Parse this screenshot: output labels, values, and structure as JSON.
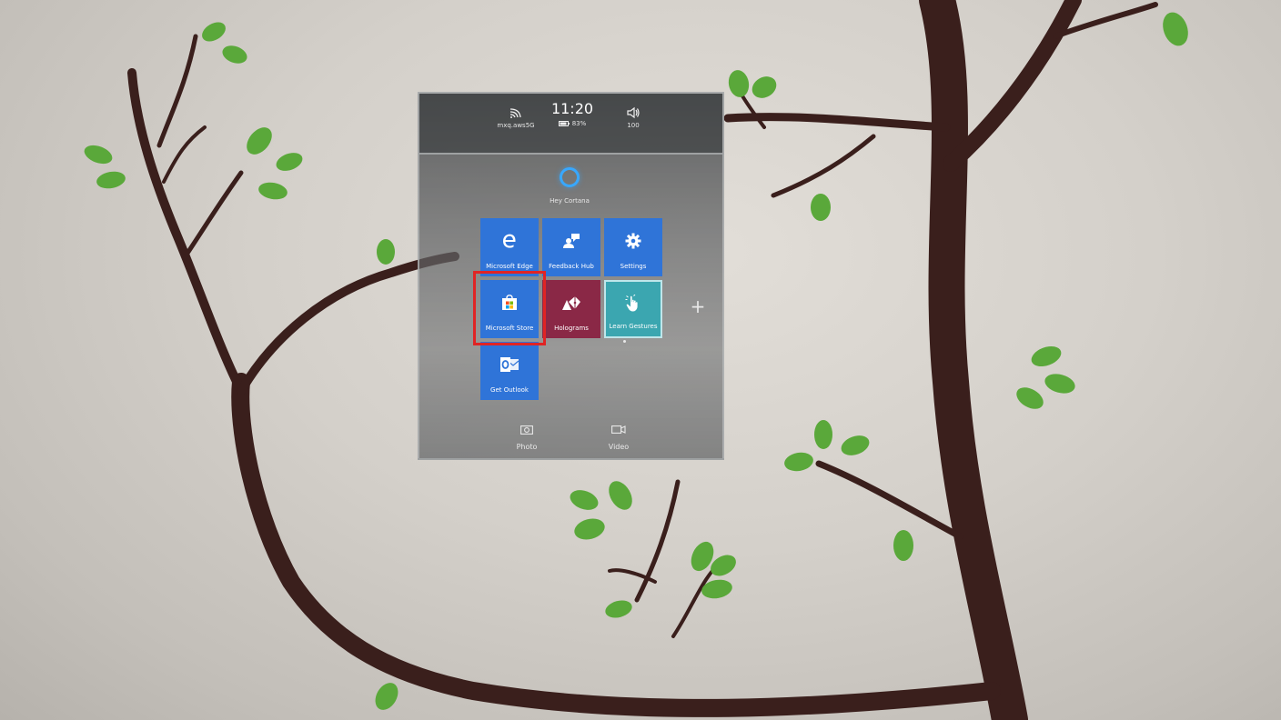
{
  "status_bar": {
    "wifi_name": "mxq.aws5G",
    "time": "11:20",
    "battery": "83%",
    "volume": "100"
  },
  "cortana": {
    "label": "Hey Cortana"
  },
  "tiles": [
    {
      "label": "Microsoft Edge",
      "icon": "edge-icon",
      "color": "#2f74d8"
    },
    {
      "label": "Feedback Hub",
      "icon": "feedback-icon",
      "color": "#2f74d8"
    },
    {
      "label": "Settings",
      "icon": "gear-icon",
      "color": "#2f74d8"
    },
    {
      "label": "Microsoft Store",
      "icon": "store-bag-icon",
      "color": "#2f74d8"
    },
    {
      "label": "Holograms",
      "icon": "holograms-icon",
      "color": "#8a2846"
    },
    {
      "label": "Learn Gestures",
      "icon": "hand-tap-icon",
      "color": "#3ba6b0"
    },
    {
      "label": "Get Outlook",
      "icon": "outlook-icon",
      "color": "#2f74d8"
    }
  ],
  "add_tile": {
    "symbol": "+"
  },
  "bottom_actions": {
    "photo_label": "Photo",
    "video_label": "Video"
  },
  "colors": {
    "highlight": "#e02424",
    "cortana_ring": "#38a8ff"
  }
}
